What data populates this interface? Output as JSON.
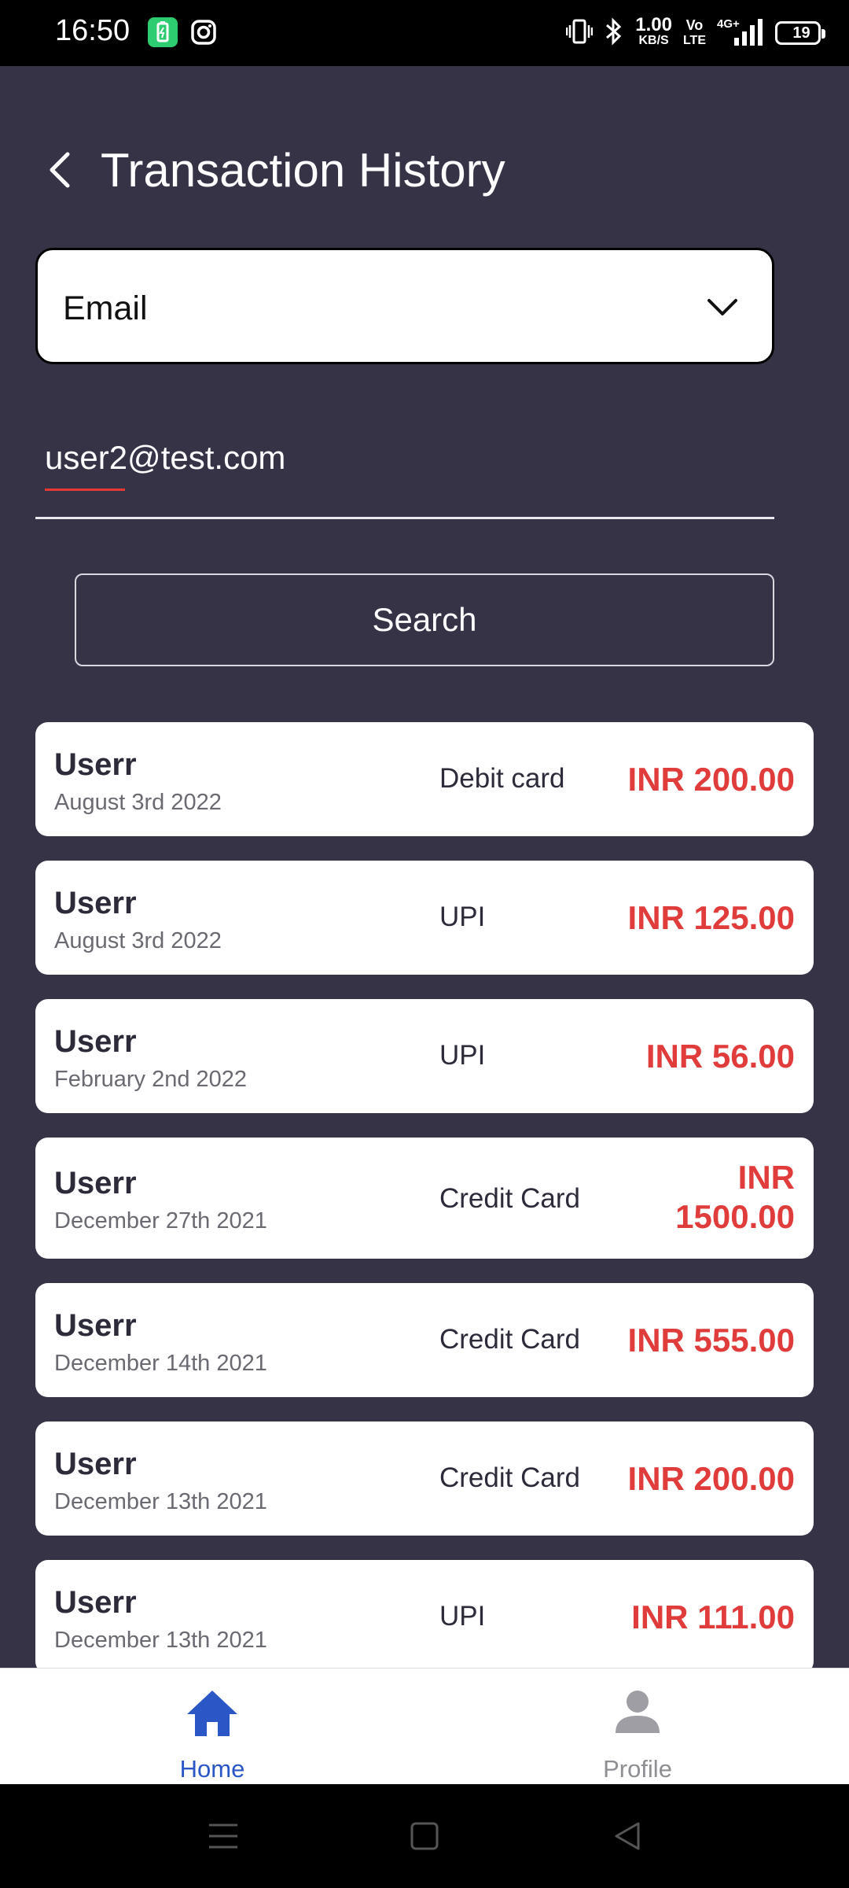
{
  "status_bar": {
    "time": "16:50",
    "net_speed_top": "1.00",
    "net_speed_bottom": "KB/S",
    "volte_top": "Vo",
    "volte_bottom": "LTE",
    "network": "4G+",
    "battery_level": "19",
    "battery_color": "#e53935"
  },
  "header": {
    "title": "Transaction History"
  },
  "filter": {
    "selected": "Email"
  },
  "email_input": {
    "value": "user2@test.com"
  },
  "search_button": {
    "label": "Search"
  },
  "transactions": [
    {
      "name": "Userr",
      "date": "August 3rd 2022",
      "method": "Debit card",
      "amount": "INR 200.00"
    },
    {
      "name": "Userr",
      "date": "August 3rd 2022",
      "method": "UPI",
      "amount": "INR 125.00"
    },
    {
      "name": "Userr",
      "date": "February 2nd 2022",
      "method": "UPI",
      "amount": "INR 56.00"
    },
    {
      "name": "Userr",
      "date": "December 27th 2021",
      "method": "Credit Card",
      "amount": "INR 1500.00"
    },
    {
      "name": "Userr",
      "date": "December 14th 2021",
      "method": "Credit Card",
      "amount": "INR 555.00"
    },
    {
      "name": "Userr",
      "date": "December 13th 2021",
      "method": "Credit Card",
      "amount": "INR 200.00"
    },
    {
      "name": "Userr",
      "date": "December 13th 2021",
      "method": "UPI",
      "amount": "INR 111.00"
    }
  ],
  "bottom_nav": {
    "home_label": "Home",
    "profile_label": "Profile",
    "active": "home",
    "active_color": "#2a56c6",
    "inactive_color": "#8e8e93"
  },
  "colors": {
    "background": "#363346",
    "amount": "#e13c3c"
  }
}
